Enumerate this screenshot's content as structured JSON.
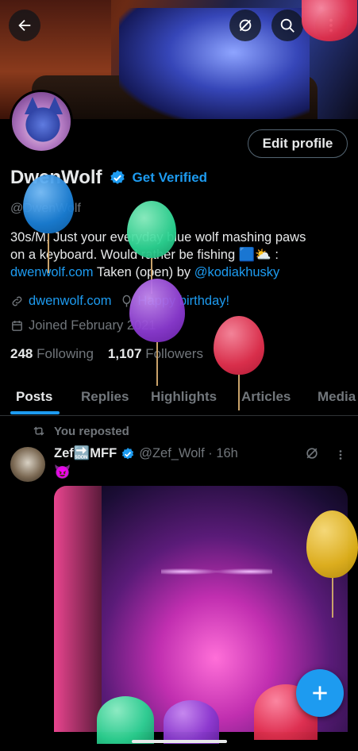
{
  "header": {
    "back_icon": "back-arrow-icon",
    "grok_icon": "grok-icon",
    "search_icon": "search-icon",
    "more_icon": "more-vertical-icon"
  },
  "profile": {
    "display_name": "DwenWolf",
    "get_verified": "Get Verified",
    "handle": "@DwenWolf",
    "edit_profile": "Edit profile",
    "bio_line1": "30s/M, Just your everyday blue wolf mashing paws",
    "bio_line2": "on a keyboard.  Would rather be fishing 🟦⛅ :",
    "bio_link": "dwenwolf.com",
    "bio_mid": " Taken (open) by ",
    "bio_mention": "@kodiakhusky",
    "website": "dwenwolf.com",
    "birthday": "Happy birthday!",
    "joined": "Joined February 2021",
    "following_count": "248",
    "following_label": "Following",
    "followers_count": "1,107",
    "followers_label": "Followers"
  },
  "tabs": [
    "Posts",
    "Replies",
    "Highlights",
    "Articles",
    "Media"
  ],
  "feed": {
    "repost_label": "You reposted",
    "post": {
      "author": "Zef🔜MFF",
      "handle_time": "@Zef_Wolf · 16h",
      "emoji": "😈"
    }
  },
  "colors": {
    "accent": "#1d9bf0",
    "text_primary": "#e7e9ea",
    "text_secondary": "#71767b",
    "background": "#000000"
  }
}
